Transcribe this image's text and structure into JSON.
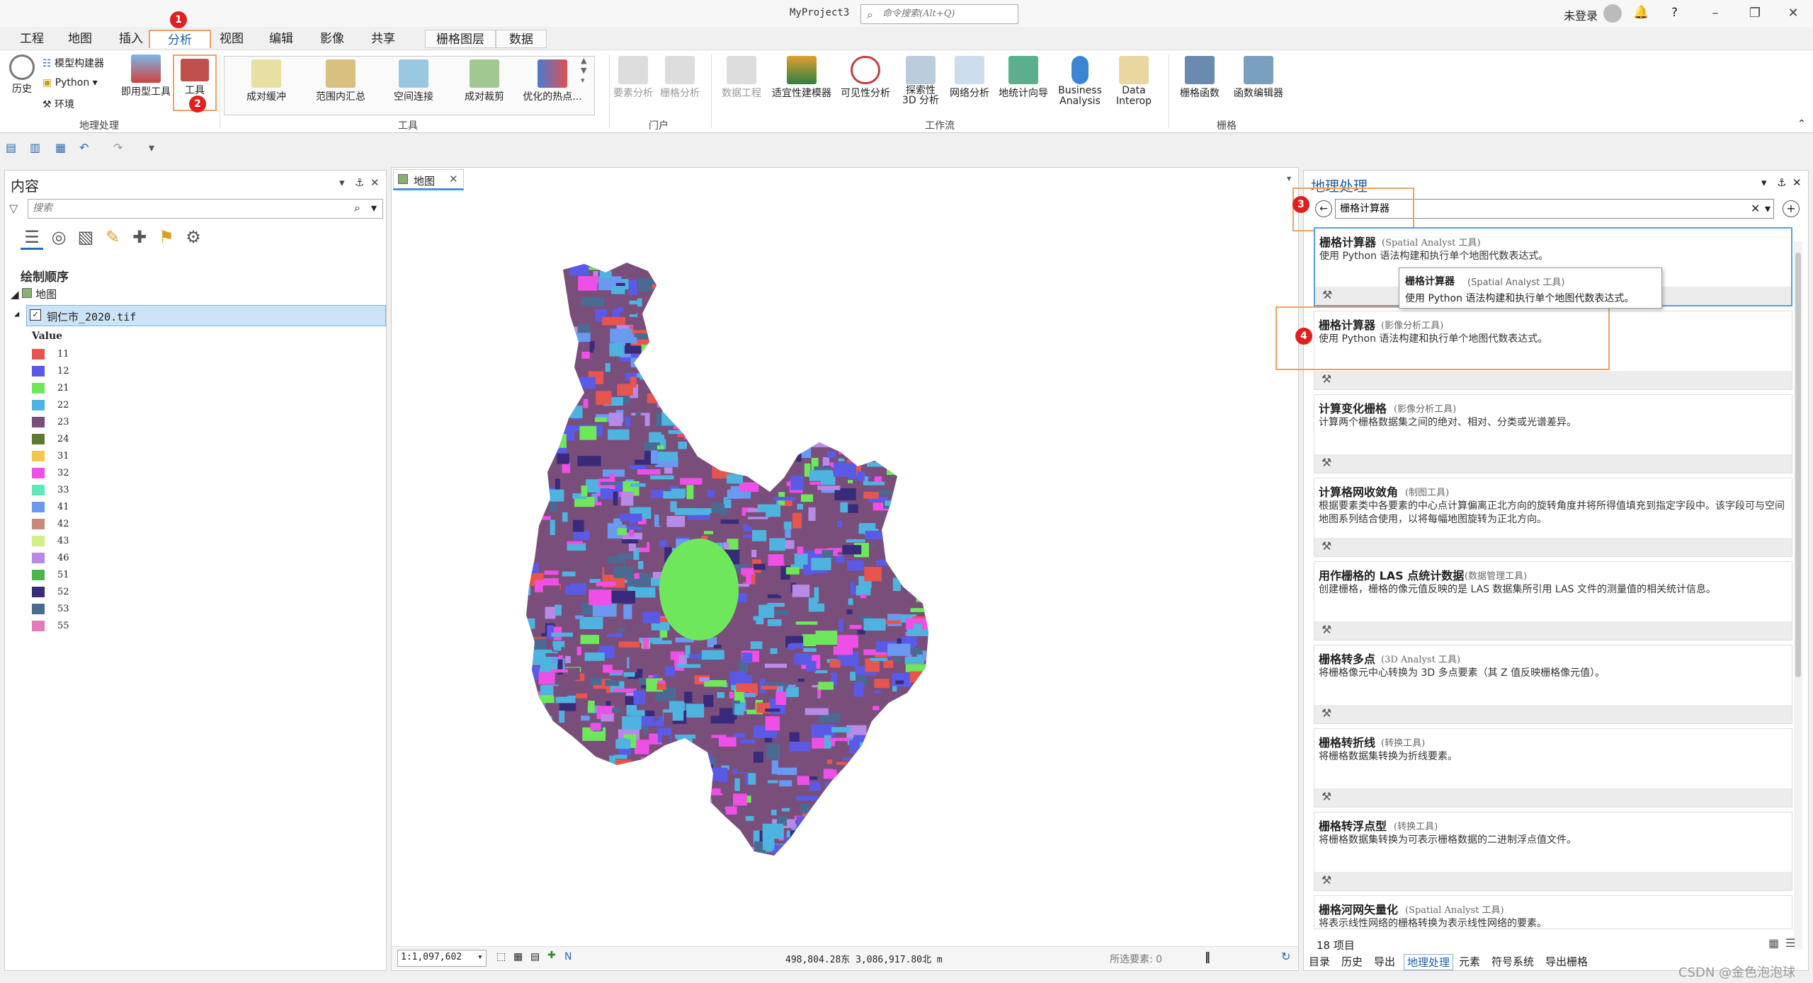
{
  "app": {
    "title": "MyProject3",
    "command_search_placeholder": "命令搜索(Alt+Q)",
    "user": "未登录",
    "help": "?"
  },
  "menu": {
    "items": [
      "工程",
      "地图",
      "插入",
      "分析",
      "视图",
      "编辑",
      "影像",
      "共享",
      "栅格图层",
      "数据"
    ],
    "active": "分析"
  },
  "ribbon": {
    "geoprocessing": {
      "history": "历史",
      "model_builder": "模型构建器",
      "python": "Python",
      "environment": "环境",
      "ready_tools": "即用型工具",
      "tools": "工具",
      "group_label": "地理处理"
    },
    "tools_gallery": {
      "items": [
        "成对缓冲",
        "范围内汇总",
        "空间连接",
        "成对裁剪",
        "优化的热点..."
      ],
      "group_label": "工具"
    },
    "portal": {
      "feature_analysis": "要素分析",
      "raster_analysis": "栅格分析",
      "group_label": "门户"
    },
    "workflows": {
      "items": [
        "数据工程",
        "适宜性建模器",
        "可见性分析",
        "探索性\n3D 分析",
        "网络分析",
        "地统计向导",
        "Business\nAnalysis",
        "Data\nInterop"
      ],
      "group_label": "工作流"
    },
    "raster": {
      "items": [
        "栅格函数",
        "函数编辑器"
      ],
      "group_label": "栅格"
    }
  },
  "contents": {
    "title": "内容",
    "search_placeholder": "搜索",
    "drawing_order": "绘制顺序",
    "map_name": "地图",
    "layer_name": "铜仁市_2020.tif",
    "value_header": "Value",
    "legend": [
      {
        "value": "11",
        "color": "#e8554f"
      },
      {
        "value": "12",
        "color": "#5a5ae6"
      },
      {
        "value": "21",
        "color": "#6ee85a"
      },
      {
        "value": "22",
        "color": "#4fb3e0"
      },
      {
        "value": "23",
        "color": "#7a4e7a"
      },
      {
        "value": "24",
        "color": "#5f7a32"
      },
      {
        "value": "31",
        "color": "#f2c84b"
      },
      {
        "value": "32",
        "color": "#ee4fe6"
      },
      {
        "value": "33",
        "color": "#5ee8b8"
      },
      {
        "value": "41",
        "color": "#6a9af0"
      },
      {
        "value": "42",
        "color": "#c88a78"
      },
      {
        "value": "43",
        "color": "#d0f08a"
      },
      {
        "value": "46",
        "color": "#b68ae6"
      },
      {
        "value": "51",
        "color": "#4cb54c"
      },
      {
        "value": "52",
        "color": "#3a2a7a"
      },
      {
        "value": "53",
        "color": "#4a6a92"
      },
      {
        "value": "55",
        "color": "#e67ab6"
      }
    ]
  },
  "map": {
    "tab": "地图",
    "scale": "1:1,097,602",
    "coordinates": "498,804.28东 3,086,917.80北 m",
    "selected_features": "所选要素: 0"
  },
  "geoprocessing": {
    "title": "地理处理",
    "search_value": "栅格计算器",
    "results": [
      {
        "name": "栅格计算器",
        "toolbox": "(Spatial Analyst 工具)",
        "desc": "使用 Python 语法构建和执行单个地图代数表达式。"
      },
      {
        "name": "栅格计算器",
        "toolbox": "(影像分析工具)",
        "desc": "使用 Python 语法构建和执行单个地图代数表达式。"
      },
      {
        "name": "计算变化栅格",
        "toolbox": "(影像分析工具)",
        "desc": "计算两个栅格数据集之间的绝对、相对、分类或光谱差异。"
      },
      {
        "name": "计算格网收敛角",
        "toolbox": "(制图工具)",
        "desc": "根据要素类中各要素的中心点计算偏离正北方向的旋转角度并将所得值填充到指定字段中。该字段可与空间地图系列结合使用，以将每幅地图旋转为正北方向。"
      },
      {
        "name": "用作栅格的 LAS 点统计数据",
        "toolbox": "(数据管理工具)",
        "desc": "创建栅格，栅格的像元值反映的是 LAS 数据集所引用 LAS 文件的测量值的相关统计信息。"
      },
      {
        "name": "栅格转多点",
        "toolbox": "(3D Analyst 工具)",
        "desc": "将栅格像元中心转换为 3D 多点要素（其 Z 值反映栅格像元值）。"
      },
      {
        "name": "栅格转折线",
        "toolbox": "(转换工具)",
        "desc": "将栅格数据集转换为折线要素。"
      },
      {
        "name": "栅格转浮点型",
        "toolbox": "(转换工具)",
        "desc": "将栅格数据集转换为可表示栅格数据的二进制浮点值文件。"
      },
      {
        "name": "栅格河网矢量化",
        "toolbox": "(Spatial Analyst 工具)",
        "desc": "将表示线性网络的栅格转换为表示线性网络的要素。"
      }
    ],
    "tooltip": {
      "name": "栅格计算器",
      "toolbox": "(Spatial Analyst 工具)",
      "desc": "使用 Python 语法构建和执行单个地图代数表达式。"
    },
    "count": "18 项目"
  },
  "bottom_tabs": [
    "目录",
    "历史",
    "导出",
    "地理处理",
    "元素",
    "符号系统",
    "导出栅格"
  ],
  "bottom_tab_active": "地理处理",
  "annotations": [
    "1",
    "2",
    "3",
    "4"
  ],
  "watermark": "CSDN @金色泡泡球"
}
